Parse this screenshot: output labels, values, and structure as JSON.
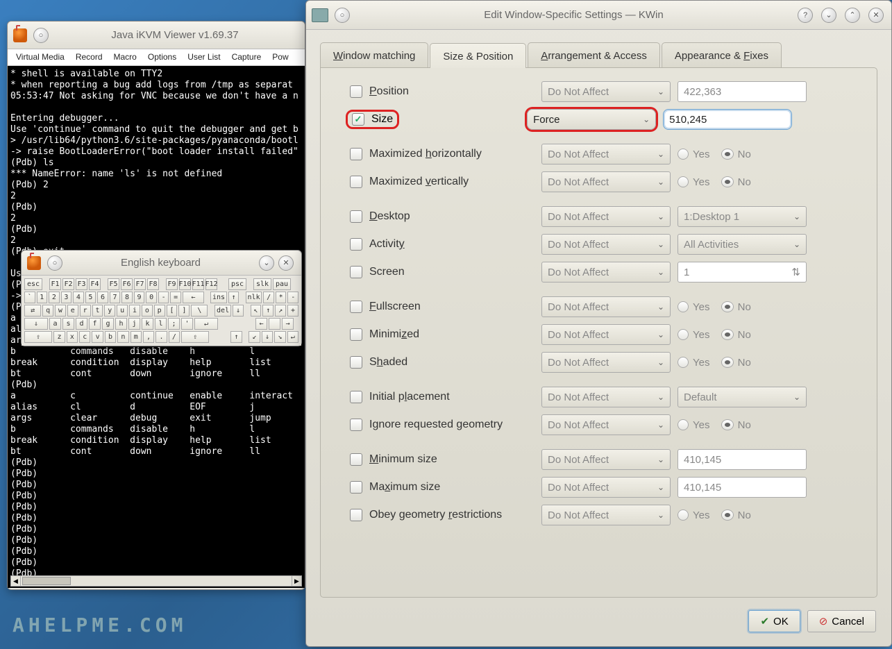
{
  "ikvm": {
    "title": "Java iKVM Viewer v1.69.37",
    "menu": [
      "Virtual Media",
      "Record",
      "Macro",
      "Options",
      "User List",
      "Capture",
      "Pow"
    ],
    "terminal_text": "* shell is available on TTY2\n* when reporting a bug add logs from /tmp as separat\n05:53:47 Not asking for VNC because we don't have a n\n\nEntering debugger...\nUse 'continue' command to quit the debugger and get b\n> /usr/lib64/python3.6/site-packages/pyanaconda/bootl\n-> raise BootLoaderError(\"boot loader install failed\"\n(Pdb) ls\n*** NameError: name 'ls' is not defined\n(Pdb) 2\n2\n(Pdb)\n2\n(Pdb)\n2\n(Pdb) exit\n\nUs\n(P\n->\n(P\na \nal\nar\nb          commands   disable    h          l\nbreak      condition  display    help       list\nbt         cont       down       ignore     ll\n(Pdb)\na          c          continue   enable     interact\nalias      cl         d          EOF        j\nargs       clear      debug      exit       jump\nb          commands   disable    h          l\nbreak      condition  display    help       list\nbt         cont       down       ignore     ll\n(Pdb)\n(Pdb)\n(Pdb)\n(Pdb)\n(Pdb)\n(Pdb)\n(Pdb)\n(Pdb)\n(Pdb)\n(Pdb)\n(Pdb)"
  },
  "kbd": {
    "title": "English keyboard"
  },
  "kwin": {
    "title": "Edit Window-Specific Settings — KWin",
    "tabs": {
      "matching": "Window matching",
      "size": "Size & Position",
      "arrangement": "Arrangement & Access",
      "appearance": "Appearance & Fixes"
    },
    "rows": {
      "position": {
        "label": "Position",
        "mode": "Do Not Affect",
        "value": "422,363"
      },
      "size": {
        "label": "Size",
        "mode": "Force",
        "value": "510,245"
      },
      "maxh": {
        "label": "Maximized horizontally",
        "mode": "Do Not Affect",
        "yes": "Yes",
        "no": "No"
      },
      "maxv": {
        "label": "Maximized vertically",
        "mode": "Do Not Affect",
        "yes": "Yes",
        "no": "No"
      },
      "desktop": {
        "label": "Desktop",
        "mode": "Do Not Affect",
        "value": "1:Desktop 1"
      },
      "activity": {
        "label": "Activity",
        "mode": "Do Not Affect",
        "value": "All Activities"
      },
      "screen": {
        "label": "Screen",
        "mode": "Do Not Affect",
        "value": "1"
      },
      "fullscreen": {
        "label": "Fullscreen",
        "mode": "Do Not Affect",
        "yes": "Yes",
        "no": "No"
      },
      "minimized": {
        "label": "Minimized",
        "mode": "Do Not Affect",
        "yes": "Yes",
        "no": "No"
      },
      "shaded": {
        "label": "Shaded",
        "mode": "Do Not Affect",
        "yes": "Yes",
        "no": "No"
      },
      "initplace": {
        "label": "Initial placement",
        "mode": "Do Not Affect",
        "value": "Default"
      },
      "ignoregeom": {
        "label": "Ignore requested geometry",
        "mode": "Do Not Affect",
        "yes": "Yes",
        "no": "No"
      },
      "minsize": {
        "label": "Minimum size",
        "mode": "Do Not Affect",
        "value": "410,145"
      },
      "maxsize": {
        "label": "Maximum size",
        "mode": "Do Not Affect",
        "value": "410,145"
      },
      "obey": {
        "label": "Obey geometry restrictions",
        "mode": "Do Not Affect",
        "yes": "Yes",
        "no": "No"
      }
    },
    "buttons": {
      "ok": "OK",
      "cancel": "Cancel"
    }
  },
  "watermark": "AHELPME.COM"
}
